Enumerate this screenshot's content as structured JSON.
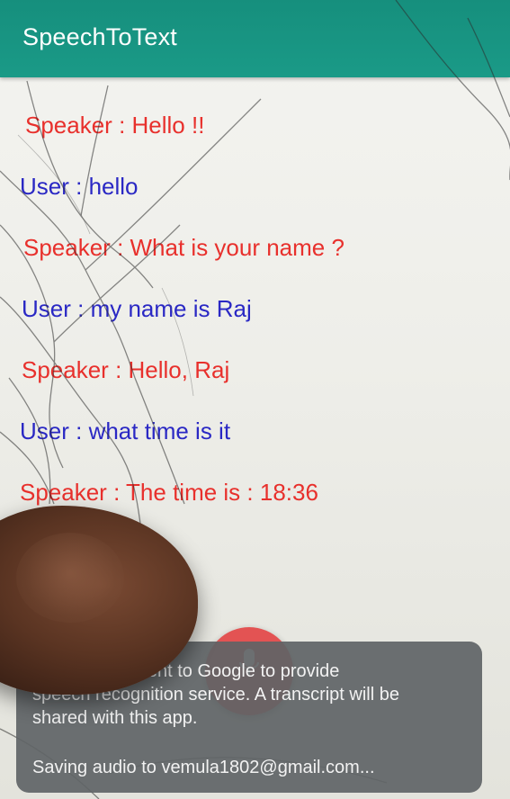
{
  "app_bar": {
    "title": "SpeechToText"
  },
  "conversation": [
    {
      "role": "speaker",
      "text": "Speaker : Hello !!"
    },
    {
      "role": "user",
      "text": "User : hello"
    },
    {
      "role": "speaker",
      "text": "Speaker : What is your name ?"
    },
    {
      "role": "user",
      "text": "User : my name is Raj"
    },
    {
      "role": "speaker",
      "text": "Speaker : Hello, Raj"
    },
    {
      "role": "user",
      "text": "User : what time is it"
    },
    {
      "role": "speaker",
      "text": "Speaker : The time is : 18:36"
    }
  ],
  "speech_dialog": {
    "notice_lines": [
      "Audio will be sent to Google to provide",
      "speech recognition service. A transcript will be",
      "shared with this app."
    ],
    "saving_text": "Saving audio to vemula1802@gmail.com..."
  },
  "colors": {
    "app_bar": "#1a9a87",
    "speaker_text": "#e8302c",
    "user_text": "#2a28c4",
    "mic_button": "#e34444",
    "dialog_background": "#606466"
  },
  "icons": {
    "mic": "microphone-icon"
  }
}
